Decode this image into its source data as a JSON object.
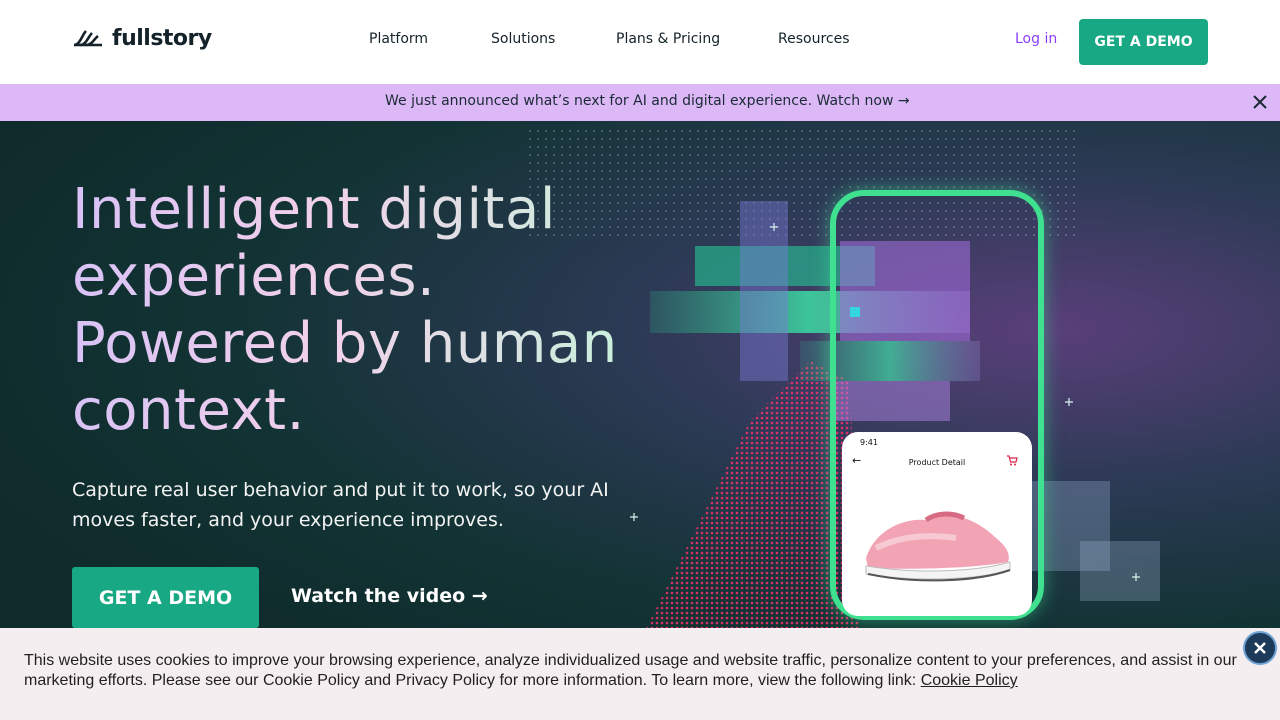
{
  "header": {
    "logo_text": "fullstory",
    "nav": [
      {
        "label": "Platform"
      },
      {
        "label": "Solutions"
      },
      {
        "label": "Plans & Pricing"
      },
      {
        "label": "Resources"
      }
    ],
    "login_label": "Log in",
    "demo_label": "GET A DEMO"
  },
  "announcement": {
    "text": "We just announced what’s next for AI and digital experience. Watch now →"
  },
  "hero": {
    "headline": "Intelligent digital experiences. Powered by human context.",
    "subtext": "Capture real user behavior and put it to work, so your AI moves faster, and your experience improves.",
    "demo_label": "GET A DEMO",
    "watch_label": "Watch the video →"
  },
  "phone_card": {
    "time": "9:41",
    "title": "Product Detail"
  },
  "cookie_banner": {
    "text": "This website uses cookies to improve your browsing experience, analyze individualized usage and website traffic, personalize content to your preferences, and assist in our marketing efforts. Please see our Cookie Policy and Privacy Policy for more information. To learn more, view the following link:",
    "link_label": "Cookie Policy"
  },
  "colors": {
    "brand_green": "#18a883",
    "login_purple": "#8a3ffc",
    "announce_bg": "#dcb8f7",
    "hero_bg": "#0f2a2a"
  }
}
